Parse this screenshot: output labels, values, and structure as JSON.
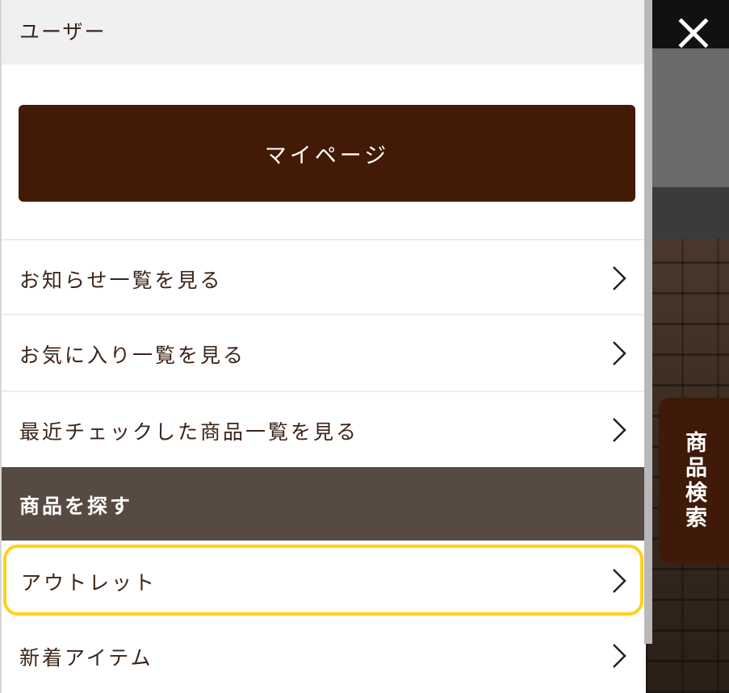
{
  "colors": {
    "brand_brown": "#431a05",
    "text_brown": "#3b2418",
    "section_bg": "#574a42",
    "highlight": "#ffd11a"
  },
  "drawer": {
    "user_header": "ユーザー",
    "mypage_button": "マイページ",
    "user_links": [
      {
        "label": "お知らせ一覧を見る",
        "icon": "chevron-right-icon"
      },
      {
        "label": "お気に入り一覧を見る",
        "icon": "chevron-right-icon"
      },
      {
        "label": "最近チェックした商品一覧を見る",
        "icon": "chevron-right-icon"
      }
    ],
    "section_title": "商品を探す",
    "product_links": [
      {
        "label": "アウトレット",
        "icon": "chevron-right-icon",
        "highlighted": true
      },
      {
        "label": "新着アイテム",
        "icon": "chevron-right-icon"
      }
    ]
  },
  "overlay": {
    "close_icon": "close-icon",
    "search_tab_label": "商品検索"
  }
}
